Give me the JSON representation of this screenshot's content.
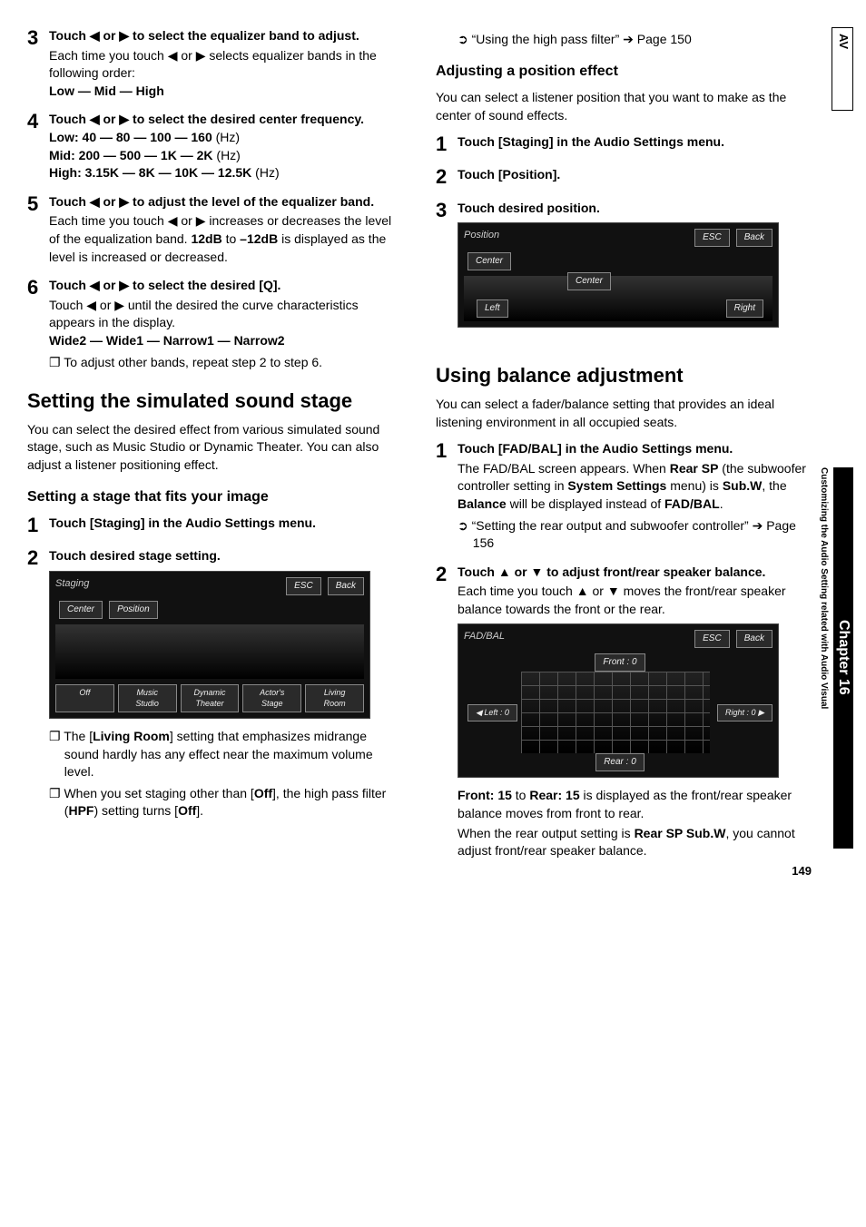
{
  "left": {
    "step3": {
      "num": "3",
      "title": "Touch ◀ or ▶ to select the equalizer band to adjust.",
      "text": "Each time you touch ◀ or ▶ selects equalizer bands in the following order:",
      "seq": "Low — Mid — High"
    },
    "step4": {
      "num": "4",
      "title": "Touch ◀ or ▶ to select the desired center frequency.",
      "low": "Low: 40 — 80 — 100 — 160",
      "low_unit": " (Hz)",
      "mid": "Mid: 200 — 500 — 1K — 2K",
      "mid_unit": " (Hz)",
      "high": "High: 3.15K — 8K — 10K — 12.5K",
      "high_unit": " (Hz)"
    },
    "step5": {
      "num": "5",
      "title": "Touch ◀ or ▶ to adjust the level of the equalizer band.",
      "text_a": "Each time you touch ◀ or ▶ increases or decreases the level of the equalization band. ",
      "level_a": "12dB",
      "mid_text": " to ",
      "level_b": "–12dB",
      "text_b": " is displayed as the level is increased or decreased."
    },
    "step6": {
      "num": "6",
      "title": "Touch ◀ or ▶ to select the desired [Q].",
      "text": "Touch ◀ or ▶ until the desired the curve characteristics appears in the display.",
      "seq": "Wide2 — Wide1 — Narrow1 — Narrow2",
      "note": "To adjust other bands, repeat step 2 to step 6."
    },
    "section_title": "Setting the simulated sound stage",
    "section_body": "You can select the desired effect from various simulated sound stage, such as Music Studio or Dynamic Theater. You can also adjust a listener positioning effect.",
    "subsection_title": "Setting a stage that fits your image",
    "s1": {
      "num": "1",
      "title": "Touch [Staging] in the Audio Settings menu."
    },
    "s2": {
      "num": "2",
      "title": "Touch desired stage setting."
    },
    "ui1": {
      "title": "Staging",
      "esc": "ESC",
      "back": "Back",
      "center": "Center",
      "position": "Position",
      "off": "Off",
      "b1": "Music Studio",
      "b2": "Dynamic Theater",
      "b3": "Actor's Stage",
      "b4": "Living Room"
    },
    "note1a": "The [",
    "note1b": "Living Room",
    "note1c": "] setting that emphasizes midrange sound hardly has any effect near the maximum volume level.",
    "note2a": "When you set staging other than [",
    "note2b": "Off",
    "note2c": "], the high pass filter (",
    "note2d": "HPF",
    "note2e": ") setting turns [",
    "note2f": "Off",
    "note2g": "]."
  },
  "right": {
    "ref1a": "“Using the high pass filter” ",
    "ref1b": "➔",
    "ref1c": " Page 150",
    "sub_title": "Adjusting a position effect",
    "sub_body": "You can select a listener position that you want to make as the center of sound effects.",
    "p1": {
      "num": "1",
      "title": "Touch [Staging] in the Audio Settings menu."
    },
    "p2": {
      "num": "2",
      "title": "Touch [Position]."
    },
    "p3": {
      "num": "3",
      "title": "Touch desired position."
    },
    "ui2": {
      "title": "Position",
      "esc": "ESC",
      "back": "Back",
      "center": "Center",
      "center2": "Center",
      "left": "Left",
      "right": "Right"
    },
    "balance_title": "Using balance adjustment",
    "balance_body": "You can select a fader/balance setting that provides an ideal listening environment in all occupied seats.",
    "b1": {
      "num": "1",
      "title": "Touch [FAD/BAL] in the Audio Settings menu.",
      "text_a": "The FAD/BAL screen appears. When ",
      "text_b": "Rear SP",
      "text_c": " (the subwoofer controller setting in ",
      "text_d": "System Settings",
      "text_e": " menu) is ",
      "text_f": "Sub.W",
      "text_g": ", the ",
      "text_h": "Balance",
      "text_i": " will be displayed instead of ",
      "text_j": "FAD/BAL",
      "text_k": ".",
      "ref_a": "“Setting the rear output and subwoofer controller” ",
      "ref_b": "➔",
      "ref_c": " Page 156"
    },
    "b2": {
      "num": "2",
      "title": "Touch ▲ or ▼ to adjust front/rear speaker balance.",
      "text": "Each time you touch ▲ or ▼ moves the front/rear speaker balance towards the front or the rear."
    },
    "ui3": {
      "title": "FAD/BAL",
      "esc": "ESC",
      "back": "Back",
      "front": "Front : 0",
      "left": "Left : 0",
      "right": "Right : 0",
      "rear": "Rear : 0"
    },
    "tail_a": "Front: 15",
    "tail_b": " to ",
    "tail_c": "Rear: 15",
    "tail_d": " is displayed as the front/rear speaker balance moves from front to rear.",
    "tail_e": "When the rear output setting is ",
    "tail_f": "Rear SP Sub.W",
    "tail_g": ", you cannot adjust front/rear speaker balance."
  },
  "rail": {
    "av": "AV",
    "chapter": "Chapter 16",
    "side": "Customizing the Audio Setting related with Audio Visual"
  },
  "page_number": "149"
}
